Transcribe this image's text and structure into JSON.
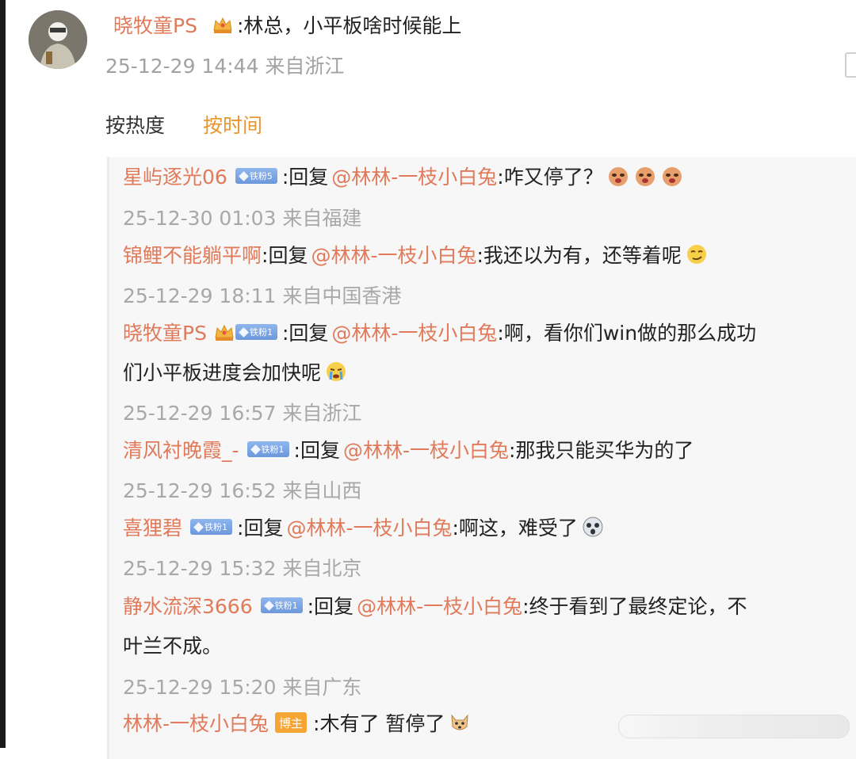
{
  "post": {
    "username": "晓牧童PS",
    "text": ":林总，小平板啥时候能上",
    "meta": "25-12-29 14:44 来自浙江"
  },
  "sort": {
    "hot": "按热度",
    "time": "按时间"
  },
  "replies": [
    {
      "username": "星屿逐光06",
      "badge": "铁粉5",
      "reply_prefix": ":回复",
      "mention": "@林林-一枝小白兔",
      "text": ":咋又停了？",
      "meta": "25-12-30 01:03 来自福建",
      "emoji": "crying-emoji"
    },
    {
      "username": "锦鲤不能躺平啊",
      "reply_prefix": ":回复",
      "mention": "@林林-一枝小白兔",
      "text": ":我还以为有，还等着呢",
      "meta": "25-12-29 18:11 来自中国香港",
      "emoji": "smirk-emoji"
    },
    {
      "username": "晓牧童PS",
      "badge": "铁粉1",
      "reply_prefix": ":回复",
      "mention": "@林林-一枝小白兔",
      "text": ":啊，看你们win做的那么成功",
      "text2": "们小平板进度会加快呢",
      "meta": "25-12-29 16:57 来自浙江",
      "emoji": "tears-emoji"
    },
    {
      "username": "清风衬晚霞_-",
      "badge": "铁粉1",
      "reply_prefix": ":回复",
      "mention": "@林林-一枝小白兔",
      "text": ":那我只能买华为的了",
      "meta": "25-12-29 16:52 来自山西"
    },
    {
      "username": "喜狸碧",
      "badge": "铁粉1",
      "reply_prefix": ":回复",
      "mention": "@林林-一枝小白兔",
      "text": ":啊这，难受了",
      "meta": "25-12-29 15:32 来自北京",
      "emoji": "shocked-emoji"
    },
    {
      "username": "静水流深3666",
      "badge": "铁粉1",
      "reply_prefix": ":回复",
      "mention": "@林林-一枝小白兔",
      "text": ":终于看到了最终定论，不",
      "text2": "叶兰不成。",
      "meta": "25-12-29 15:20 来自广东"
    },
    {
      "username": "林林-一枝小白兔",
      "badge_author": "博主",
      "text": ":木有了 暂停了",
      "emoji": "dog-emoji"
    }
  ]
}
